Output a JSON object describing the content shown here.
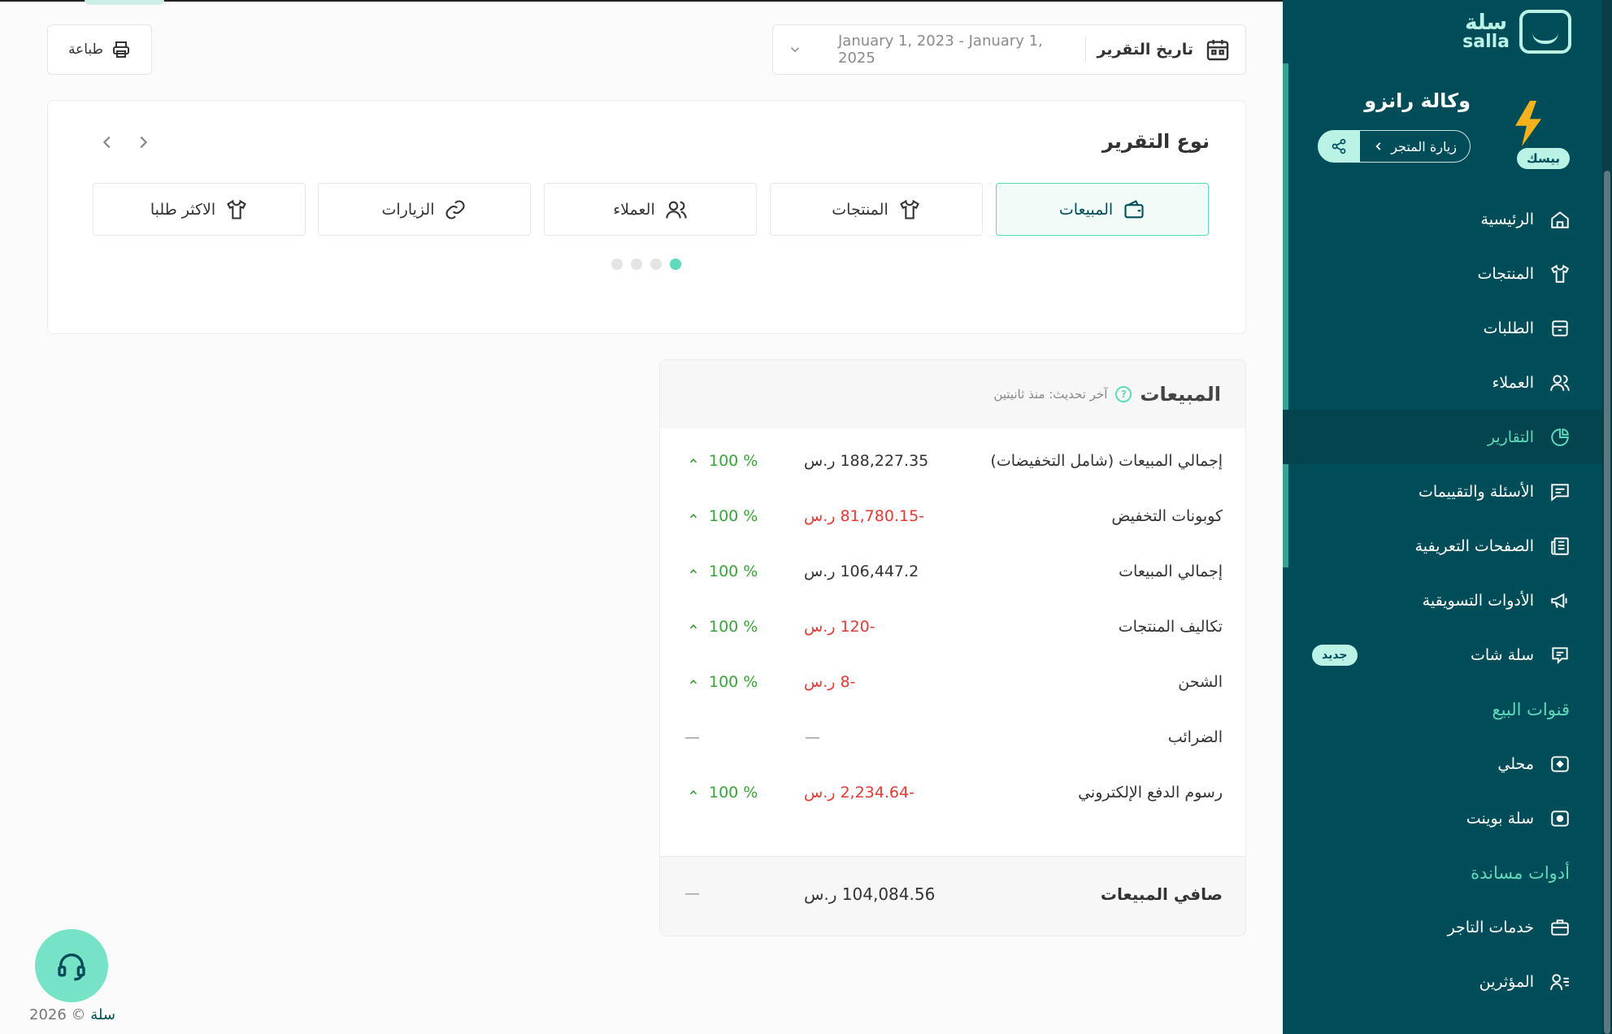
{
  "header": {
    "print_label": "طباعة",
    "date_label": "تاريخ التقرير",
    "date_range": "January 1, 2023 - January 1, 2025"
  },
  "report_type": {
    "title": "نوع التقرير",
    "tabs": [
      {
        "label": "المبيعات",
        "icon": "wallet-icon",
        "active": true
      },
      {
        "label": "المنتجات",
        "icon": "shirt-icon",
        "active": false
      },
      {
        "label": "العملاء",
        "icon": "users-icon",
        "active": false
      },
      {
        "label": "الزيارات",
        "icon": "link-icon",
        "active": false
      },
      {
        "label": "الاكثر طلبا",
        "icon": "shirt-icon",
        "active": false
      }
    ],
    "page_dots": 4,
    "active_dot": 1
  },
  "sales": {
    "title": "المبيعات",
    "last_update": "آخر تحديث: منذ ثانيتين",
    "rows": [
      {
        "name": "إجمالي المبيعات (شامل التخفيضات)",
        "amount": "188,227.35 ر.س",
        "negative": false,
        "change": "100 %"
      },
      {
        "name": "كوبونات التخفيض",
        "amount": "-81,780.15 ر.س",
        "negative": true,
        "change": "100 %"
      },
      {
        "name": "إجمالي المبيعات",
        "amount": "106,447.2 ر.س",
        "negative": false,
        "change": "100 %"
      },
      {
        "name": "تكاليف المنتجات",
        "amount": "-120 ر.س",
        "negative": true,
        "change": "100 %"
      },
      {
        "name": "الشحن",
        "amount": "-8 ر.س",
        "negative": true,
        "change": "100 %"
      },
      {
        "name": "الضرائب",
        "amount": "—",
        "negative": false,
        "change": "—"
      },
      {
        "name": "رسوم الدفع الإلكتروني",
        "amount": "-2,234.64 ر.س",
        "negative": true,
        "change": "100 %"
      }
    ],
    "net_label": "صافي المبيعات",
    "net_amount": "104,084.56 ر.س",
    "net_change": "—"
  },
  "sidebar": {
    "logo_ar": "سلة",
    "logo_en": "salla",
    "store_name": "وكالة رانزو",
    "plan": "بيسك",
    "visit_label": "زيارة المتجر",
    "items": [
      {
        "label": "الرئيسية",
        "icon": "home-icon"
      },
      {
        "label": "المنتجات",
        "icon": "shirt-icon"
      },
      {
        "label": "الطلبات",
        "icon": "box-icon"
      },
      {
        "label": "العملاء",
        "icon": "users-icon"
      },
      {
        "label": "التقارير",
        "icon": "pie-chart-icon",
        "active": true
      },
      {
        "label": "الأسئلة والتقييمات",
        "icon": "message-icon"
      },
      {
        "label": "الصفحات التعريفية",
        "icon": "newspaper-icon"
      },
      {
        "label": "الأدوات التسويقية",
        "icon": "megaphone-icon"
      },
      {
        "label": "سلة شات",
        "icon": "chat-icon",
        "badge": "جديد"
      }
    ],
    "section_channels": "قنوات البيع",
    "channels": [
      {
        "label": "محلي",
        "icon": "store-icon"
      },
      {
        "label": "سلة بوينت",
        "icon": "pos-icon"
      }
    ],
    "section_tools": "أدوات مساندة",
    "tools": [
      {
        "label": "خدمات التاجر",
        "icon": "briefcase-icon"
      },
      {
        "label": "المؤثرين",
        "icon": "influencer-icon"
      }
    ]
  },
  "footer": {
    "copyright_prefix": "2026 ©",
    "brand": "سلة"
  },
  "colors": {
    "sidebar_bg": "#004d5a",
    "accent": "#5ddab9",
    "negative": "#e53935",
    "positive": "#3aa43a"
  }
}
